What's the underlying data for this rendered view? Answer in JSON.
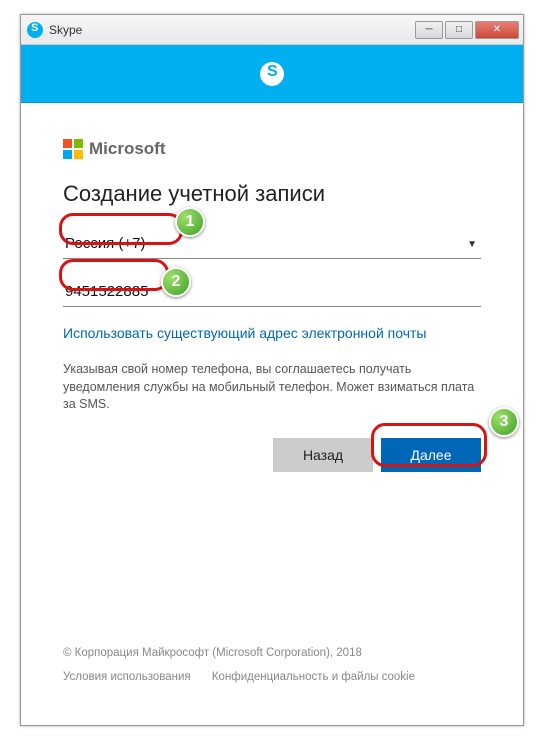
{
  "window": {
    "title": "Skype"
  },
  "brand": {
    "microsoft": "Microsoft"
  },
  "heading": "Создание учетной записи",
  "country": {
    "selected": "Россия (+7)"
  },
  "phone": {
    "value": "9451522885"
  },
  "links": {
    "use_email": "Использовать существующий адрес электронной почты"
  },
  "disclosure": "Указывая свой номер телефона, вы соглашаетесь получать уведомления службы на мобильный телефон. Может взиматься плата за SMS.",
  "buttons": {
    "back": "Назад",
    "next": "Далее"
  },
  "footer": {
    "copyright": "© Корпорация Майкрософт (Microsoft Corporation), 2018",
    "terms": "Условия использования",
    "privacy": "Конфиденциальность и файлы cookie"
  },
  "markers": {
    "m1": "1",
    "m2": "2",
    "m3": "3"
  }
}
